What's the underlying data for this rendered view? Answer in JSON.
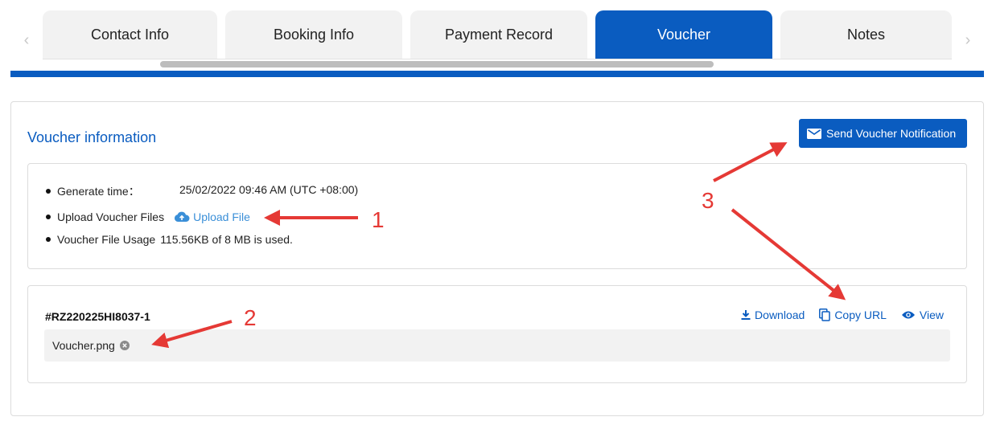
{
  "tabs": [
    {
      "label": "Contact Info",
      "active": false
    },
    {
      "label": "Booking Info",
      "active": false
    },
    {
      "label": "Payment Record",
      "active": false
    },
    {
      "label": "Voucher",
      "active": true
    },
    {
      "label": "Notes",
      "active": false
    }
  ],
  "nav": {
    "prev": "‹",
    "next": "›"
  },
  "voucher": {
    "title": "Voucher information",
    "send_button": "Send Voucher Notification",
    "generate_time_label": "Generate time：",
    "generate_time_value": "25/02/2022 09:46 AM (UTC +08:00)",
    "upload_label": "Upload Voucher Files",
    "upload_link": "Upload File",
    "usage_label": "Voucher File Usage",
    "usage_value": "115.56KB of 8 MB is used."
  },
  "file": {
    "id": "#RZ220225HI8037-1",
    "download": "Download",
    "copy_url": "Copy URL",
    "view": "View",
    "filename": "Voucher.png"
  },
  "annotations": [
    "1",
    "2",
    "3"
  ],
  "colors": {
    "accent": "#0a5cc0",
    "link": "#3a8fd8",
    "annotation": "#e53935"
  }
}
